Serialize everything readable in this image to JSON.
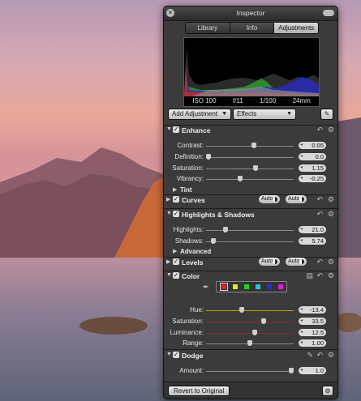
{
  "window": {
    "title": "Inspector"
  },
  "tabs": [
    {
      "label": "Library",
      "active": false
    },
    {
      "label": "Info",
      "active": false
    },
    {
      "label": "Adjustments",
      "active": true
    }
  ],
  "exif": {
    "iso": "ISO 100",
    "aperture": "f/11",
    "shutter": "1/100",
    "focal": "24mm"
  },
  "toolbar": {
    "add_adjustment": "Add Adjustment",
    "effects": "Effects"
  },
  "enhance": {
    "label": "Enhance",
    "rows": [
      {
        "name": "Contrast:",
        "value": "0.05",
        "level": 0.55
      },
      {
        "name": "Definition:",
        "value": "0.0",
        "level": 0.0
      },
      {
        "name": "Saturation:",
        "value": "1.15",
        "level": 0.57
      },
      {
        "name": "Vibrancy:",
        "value": "-0.25",
        "level": 0.38
      }
    ],
    "tint_label": "Tint"
  },
  "curves": {
    "label": "Curves",
    "auto1": "Auto",
    "auto2": "Auto"
  },
  "highlights_shadows": {
    "label": "Highlights & Shadows",
    "rows": [
      {
        "name": "Highlights:",
        "value": "21.0",
        "level": 0.21
      },
      {
        "name": "Shadows:",
        "value": "5.74",
        "level": 0.06
      }
    ],
    "advanced_label": "Advanced"
  },
  "levels": {
    "label": "Levels",
    "auto1": "Auto",
    "auto2": "Auto"
  },
  "color": {
    "label": "Color",
    "swatches": [
      "#e82020",
      "#e8e820",
      "#20d820",
      "#20c8d8",
      "#2030e8",
      "#d820d8"
    ],
    "selected_swatch": 0,
    "rows": [
      {
        "name": "Hue:",
        "value": "-13.4",
        "level": 0.4,
        "track": "#b8a000"
      },
      {
        "name": "Saturation:",
        "value": "33.5",
        "level": 0.67,
        "track": "#8a2a2a"
      },
      {
        "name": "Luminance:",
        "value": "12.5",
        "level": 0.56,
        "track": "#8a2a2a"
      },
      {
        "name": "Range:",
        "value": "1.00",
        "level": 0.5,
        "track": "#8a8a8a"
      }
    ]
  },
  "dodge": {
    "label": "Dodge",
    "rows": [
      {
        "name": "Amount:",
        "value": "1.0",
        "level": 1.0
      }
    ]
  },
  "footer": {
    "revert": "Revert to Original"
  },
  "colors": {
    "panel": "#3b3b3b",
    "accent_selected_tab": "#c4c4c4"
  }
}
